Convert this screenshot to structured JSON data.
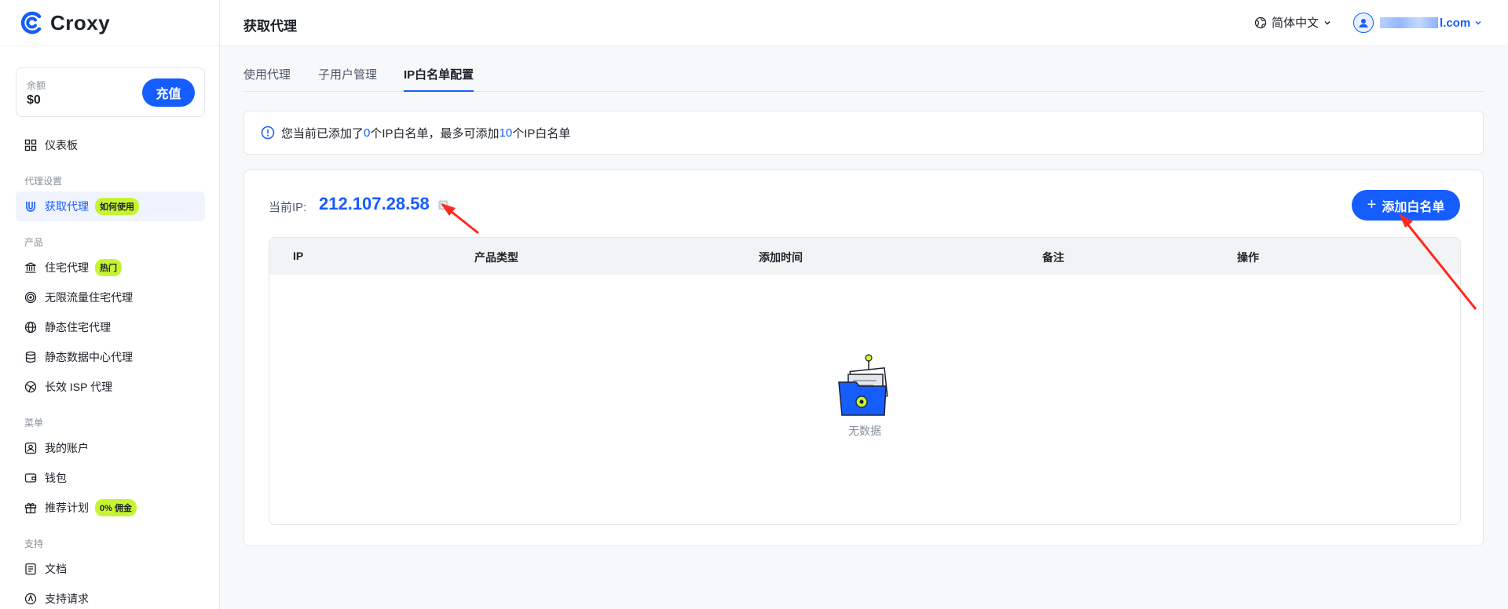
{
  "brand": {
    "name": "Croxy"
  },
  "colors": {
    "primary": "#165dff",
    "badge": "#c6f432",
    "annotation": "#ff2a1f"
  },
  "sidebar": {
    "balance_label": "余额",
    "balance_value": "$0",
    "recharge_label": "充值",
    "dashboard": "仪表板",
    "sections": {
      "proxy_settings": "代理设置",
      "products": "产品",
      "menu": "菜单",
      "support": "支持"
    },
    "get_proxy": {
      "label": "获取代理",
      "badge": "如何使用"
    },
    "products": [
      {
        "label": "住宅代理",
        "badge": "热门",
        "icon": "bank-icon"
      },
      {
        "label": "无限流量住宅代理",
        "icon": "target-icon"
      },
      {
        "label": "静态住宅代理",
        "icon": "globe-icon"
      },
      {
        "label": "静态数据中心代理",
        "icon": "database-icon"
      },
      {
        "label": "长效 ISP 代理",
        "icon": "network-icon"
      }
    ],
    "menu": [
      {
        "label": "我的账户",
        "icon": "user-card-icon"
      },
      {
        "label": "钱包",
        "icon": "wallet-icon"
      },
      {
        "label": "推荐计划",
        "badge": "0% 佣金",
        "icon": "gift-icon"
      }
    ],
    "support": [
      {
        "label": "文档",
        "icon": "document-icon"
      },
      {
        "label": "支持请求",
        "icon": "support-icon"
      }
    ]
  },
  "header": {
    "title": "获取代理",
    "language": "简体中文",
    "email_suffix": "l.com"
  },
  "tabs": [
    {
      "label": "使用代理"
    },
    {
      "label": "子用户管理"
    },
    {
      "label": "IP白名单配置",
      "active": true
    }
  ],
  "notice": {
    "prefix": "您当前已添加了",
    "count": "0",
    "middle": "个IP白名单，最多可添加",
    "max": "10",
    "suffix": "个IP白名单"
  },
  "whitelist": {
    "current_ip_label": "当前IP:",
    "current_ip": "212.107.28.58",
    "add_button": "添加白名单",
    "columns": [
      "IP",
      "产品类型",
      "添加时间",
      "备注",
      "操作"
    ],
    "empty_text": "无数据"
  }
}
